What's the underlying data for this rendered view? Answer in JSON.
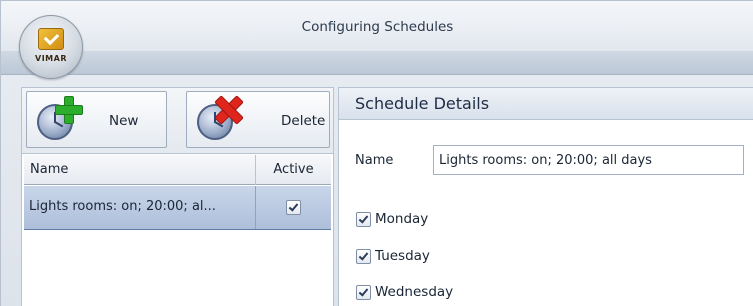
{
  "window": {
    "title": "Configuring Schedules",
    "logo_text": "VIMAR"
  },
  "toolbar": {
    "new_label": "New",
    "delete_label": "Delete"
  },
  "schedules_list": {
    "columns": [
      "Name",
      "Active"
    ],
    "rows": [
      {
        "name": "Lights rooms: on; 20:00; al...",
        "active": true,
        "selected": true
      }
    ]
  },
  "details": {
    "title": "Schedule Details",
    "name_label": "Name",
    "name_value": "Lights rooms: on; 20:00; all days",
    "days": [
      {
        "label": "Monday",
        "checked": true
      },
      {
        "label": "Tuesday",
        "checked": true
      },
      {
        "label": "Wednesday",
        "checked": true
      }
    ]
  },
  "colors": {
    "selected_row": "#b9c8e0",
    "add_icon": "#2cae2c",
    "delete_icon": "#e0261c"
  },
  "icons": {
    "app_button": "vimar-logo-icon",
    "new": "clock-plus-icon",
    "delete": "clock-delete-icon"
  }
}
